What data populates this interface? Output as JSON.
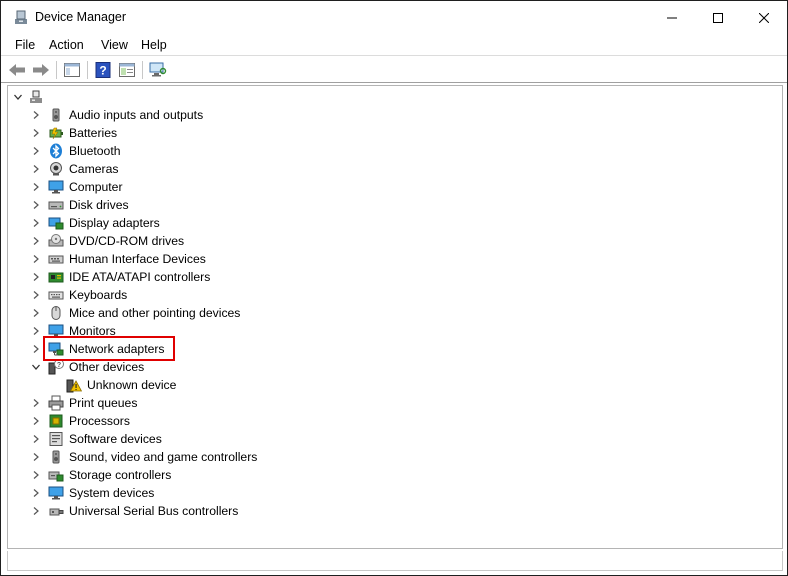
{
  "window": {
    "title": "Device Manager"
  },
  "menu": [
    "File",
    "Action",
    "View",
    "Help"
  ],
  "toolbar": [
    "back-icon",
    "forward-icon",
    "show-hide-console-tree-icon",
    "help-icon",
    "properties-icon",
    "scan-hardware-icon"
  ],
  "tree": {
    "root_icon": "computer-root-icon",
    "categories": [
      {
        "label": "Audio inputs and outputs",
        "icon": "speaker-icon",
        "expanded": false
      },
      {
        "label": "Batteries",
        "icon": "battery-icon",
        "expanded": false
      },
      {
        "label": "Bluetooth",
        "icon": "bluetooth-icon",
        "expanded": false
      },
      {
        "label": "Cameras",
        "icon": "camera-icon",
        "expanded": false
      },
      {
        "label": "Computer",
        "icon": "monitor-icon",
        "expanded": false
      },
      {
        "label": "Disk drives",
        "icon": "disk-drive-icon",
        "expanded": false
      },
      {
        "label": "Display adapters",
        "icon": "display-adapter-icon",
        "expanded": false
      },
      {
        "label": "DVD/CD-ROM drives",
        "icon": "dvd-drive-icon",
        "expanded": false
      },
      {
        "label": "Human Interface Devices",
        "icon": "hid-icon",
        "expanded": false
      },
      {
        "label": "IDE ATA/ATAPI controllers",
        "icon": "ide-controller-icon",
        "expanded": false
      },
      {
        "label": "Keyboards",
        "icon": "keyboard-icon",
        "expanded": false
      },
      {
        "label": "Mice and other pointing devices",
        "icon": "mouse-icon",
        "expanded": false
      },
      {
        "label": "Monitors",
        "icon": "monitor-icon",
        "expanded": false
      },
      {
        "label": "Network adapters",
        "icon": "network-adapter-icon",
        "expanded": false,
        "highlighted": true
      },
      {
        "label": "Other devices",
        "icon": "unknown-device-category-icon",
        "expanded": true,
        "children": [
          {
            "label": "Unknown device",
            "icon": "warning-device-icon"
          }
        ]
      },
      {
        "label": "Print queues",
        "icon": "printer-icon",
        "expanded": false
      },
      {
        "label": "Processors",
        "icon": "processor-icon",
        "expanded": false
      },
      {
        "label": "Software devices",
        "icon": "software-device-icon",
        "expanded": false
      },
      {
        "label": "Sound, video and game controllers",
        "icon": "speaker-icon",
        "expanded": false
      },
      {
        "label": "Storage controllers",
        "icon": "storage-controller-icon",
        "expanded": false
      },
      {
        "label": "System devices",
        "icon": "system-device-icon",
        "expanded": false
      },
      {
        "label": "Universal Serial Bus controllers",
        "icon": "usb-icon",
        "expanded": false
      }
    ]
  },
  "colors": {
    "highlight_border": "#e00000",
    "accent": "#1e7fd6"
  }
}
